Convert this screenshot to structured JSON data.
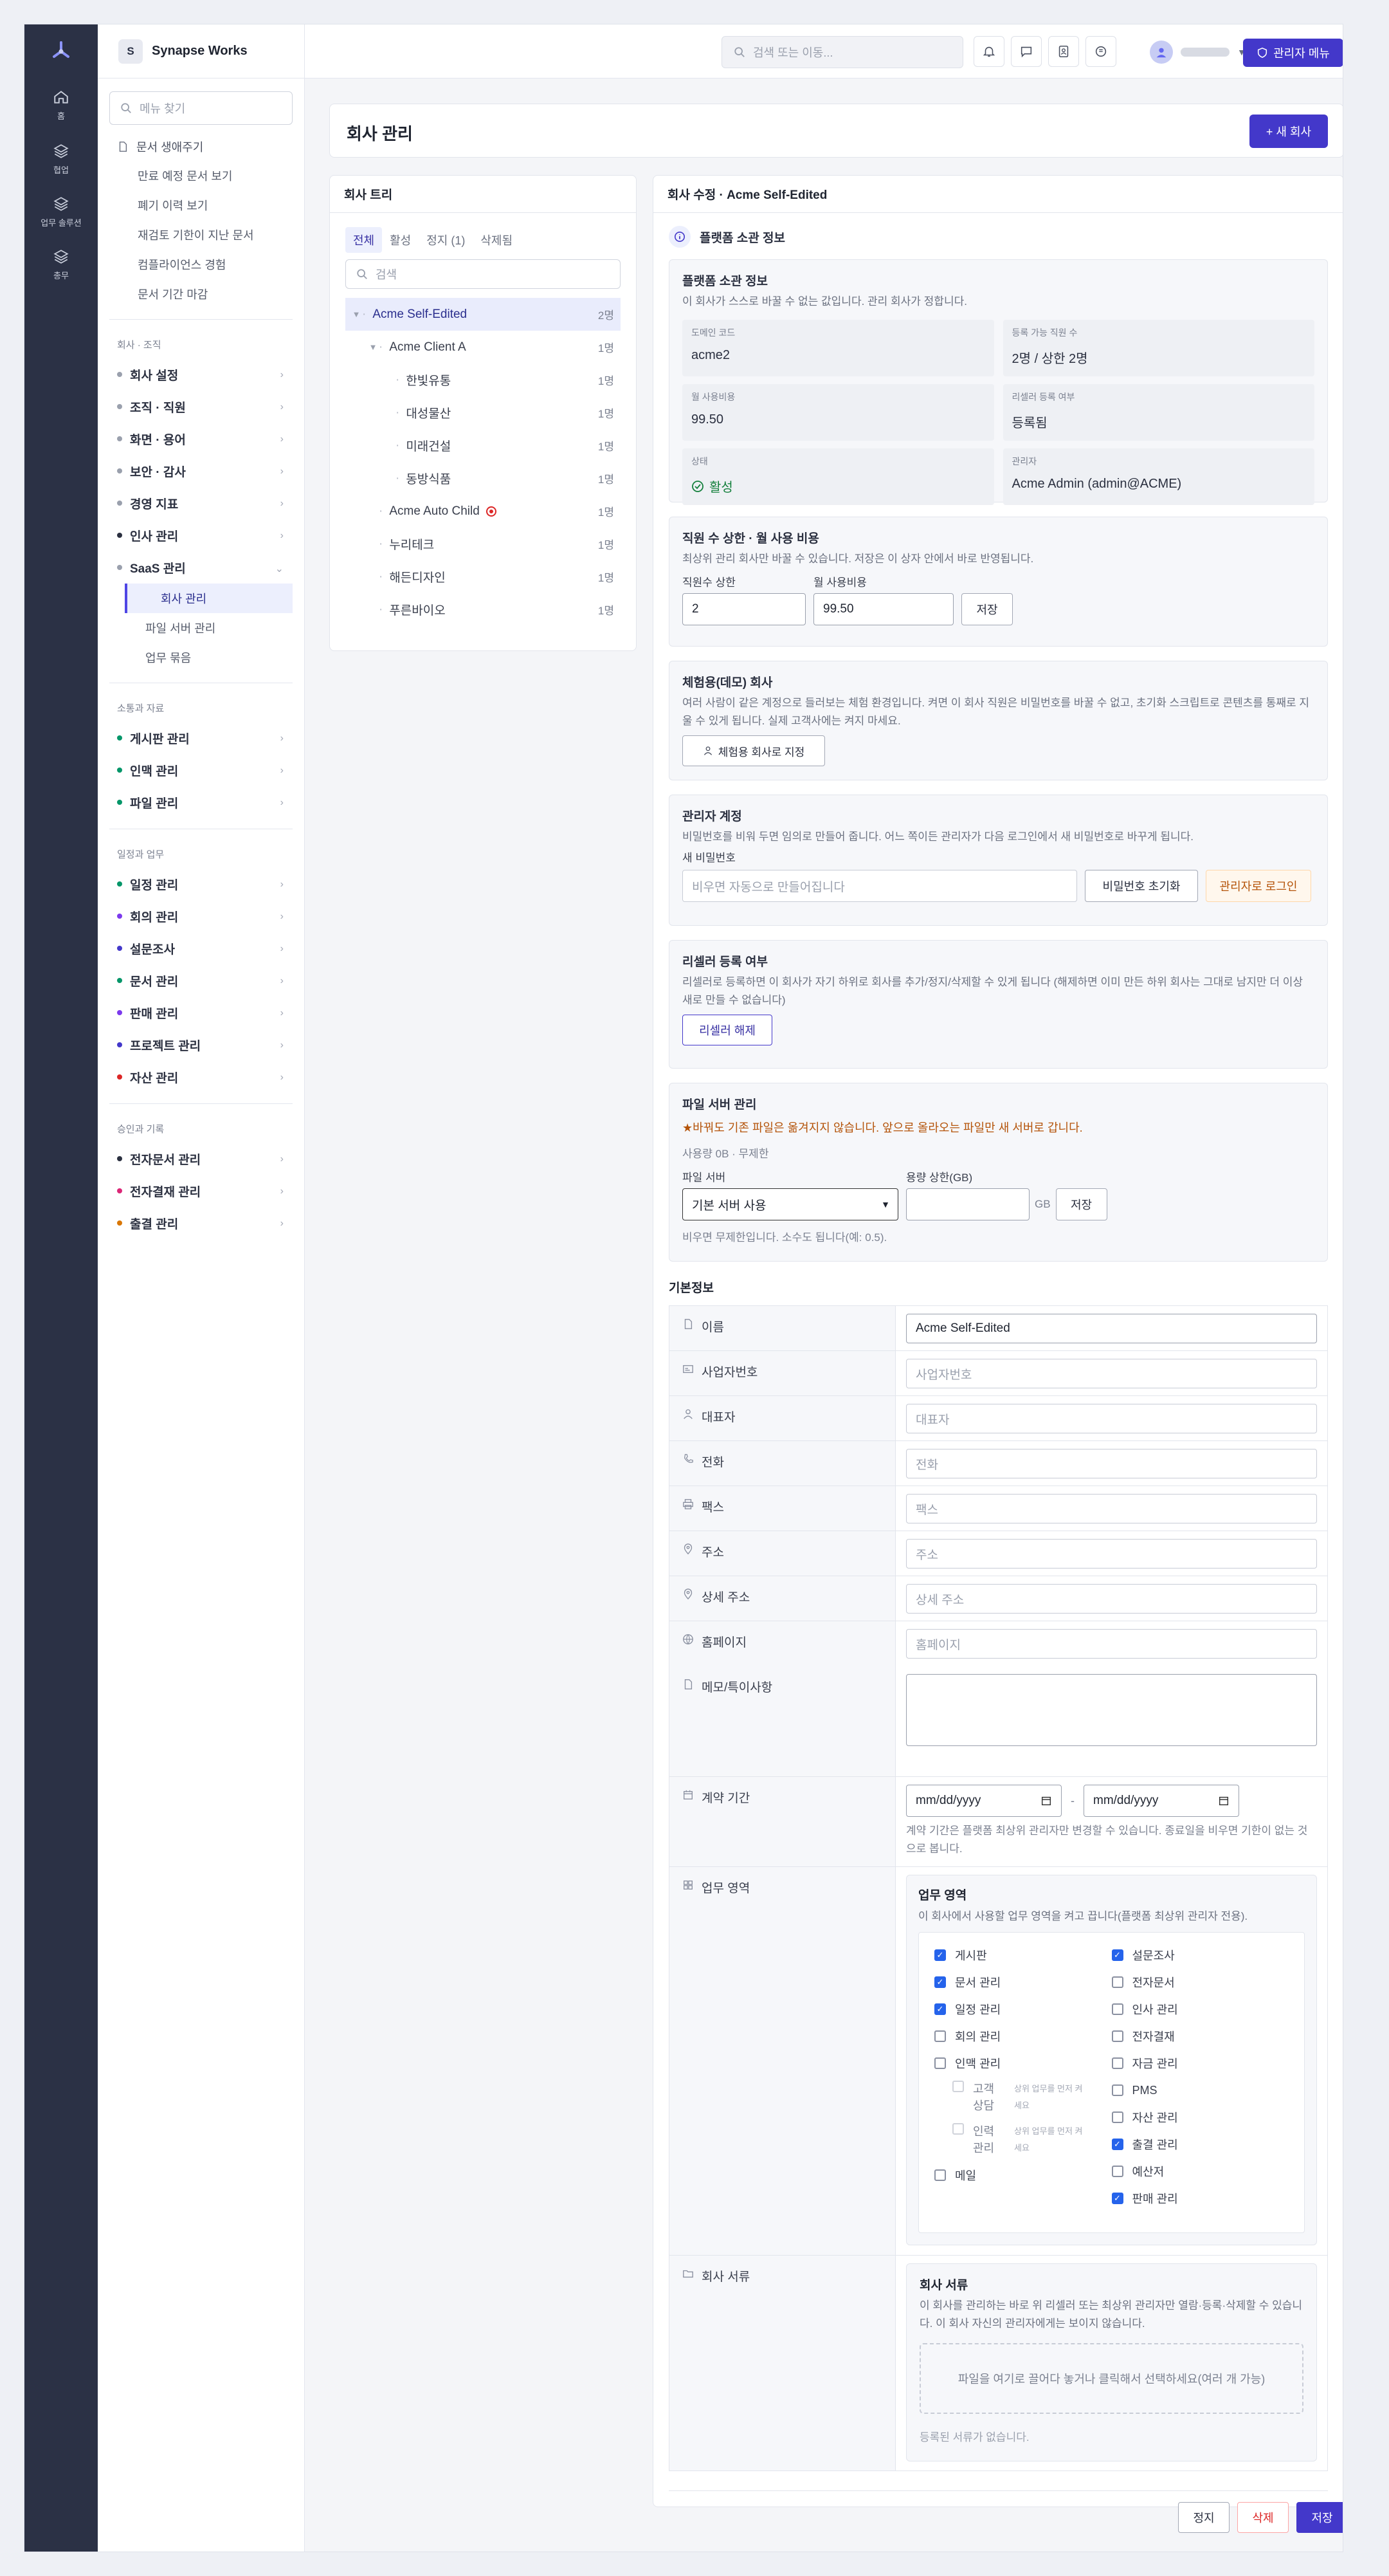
{
  "rail": {
    "items": [
      {
        "label": "홈",
        "icon": "home-icon"
      },
      {
        "label": "협업",
        "icon": "layers-icon"
      },
      {
        "label": "업무 솔루션",
        "icon": "layers-icon"
      },
      {
        "label": "총무",
        "icon": "layers-icon"
      }
    ]
  },
  "brand": {
    "initial": "S",
    "name": "Synapse Works"
  },
  "menu_search": {
    "placeholder": "메뉴 찾기"
  },
  "doc_lifecycle": {
    "title": "문서 생애주기",
    "items": [
      "만료 예정 문서 보기",
      "폐기 이력 보기",
      "재검토 기한이 지난 문서",
      "컴플라이언스 경험",
      "문서 기간 마감"
    ]
  },
  "sidebar": {
    "sections": [
      {
        "category": "회사 · 조직",
        "items": [
          {
            "label": "회사 설정",
            "color": "#9aa0ad"
          },
          {
            "label": "조직 · 직원",
            "color": "#9aa0ad"
          },
          {
            "label": "화면 · 용어",
            "color": "#9aa0ad"
          },
          {
            "label": "보안 · 감사",
            "color": "#9aa0ad"
          },
          {
            "label": "경영 지표",
            "color": "#9aa0ad"
          },
          {
            "label": "인사 관리",
            "color": "#2b3040"
          },
          {
            "label": "SaaS 관리",
            "color": "#9aa0ad"
          }
        ]
      },
      {
        "category": "소통과 자료",
        "items": [
          {
            "label": "게시판 관리",
            "color": "#059669"
          },
          {
            "label": "인맥 관리",
            "color": "#059669"
          },
          {
            "label": "파일 관리",
            "color": "#059669"
          }
        ]
      },
      {
        "category": "일정과 업무",
        "items": [
          {
            "label": "일정 관리",
            "color": "#059669"
          },
          {
            "label": "회의 관리",
            "color": "#7c3aed"
          },
          {
            "label": "설문조사",
            "color": "#4338ca"
          },
          {
            "label": "문서 관리",
            "color": "#059669"
          },
          {
            "label": "판매 관리",
            "color": "#7c3aed"
          },
          {
            "label": "프로젝트 관리",
            "color": "#4338ca"
          },
          {
            "label": "자산 관리",
            "color": "#dc2626"
          }
        ]
      },
      {
        "category": "승인과 기록",
        "items": [
          {
            "label": "전자문서 관리",
            "color": "#2b3040"
          },
          {
            "label": "전자결재 관리",
            "color": "#db2777"
          },
          {
            "label": "출결 관리",
            "color": "#d97706"
          }
        ]
      }
    ],
    "saas_children": [
      "회사 관리",
      "파일 서버 관리",
      "업무 묶음"
    ]
  },
  "topbar": {
    "search_placeholder": "검색 또는 이동...",
    "admin_menu_label": "관리자 메뉴"
  },
  "page": {
    "title": "회사 관리",
    "new_button": "+ 새 회사"
  },
  "tree_panel": {
    "title": "회사 트리",
    "tabs": [
      "전체",
      "활성",
      "정지 (1)",
      "삭제됨"
    ],
    "search_placeholder": "검색",
    "rows": [
      {
        "name": "Acme Self-Edited",
        "count": "2명",
        "level": 0,
        "toggle": "▼"
      },
      {
        "name": "Acme Client A",
        "count": "1명",
        "level": 1,
        "toggle": "▼"
      },
      {
        "name": "한빛유통",
        "count": "1명",
        "level": 2
      },
      {
        "name": "대성물산",
        "count": "1명",
        "level": 2
      },
      {
        "name": "미래건설",
        "count": "1명",
        "level": 2
      },
      {
        "name": "동방식품",
        "count": "1명",
        "level": 2
      },
      {
        "name": "Acme Auto Child",
        "count": "1명",
        "level": 1,
        "flag": true
      },
      {
        "name": "누리테크",
        "count": "1명",
        "level": 1
      },
      {
        "name": "해든디자인",
        "count": "1명",
        "level": 1
      },
      {
        "name": "푸른바이오",
        "count": "1명",
        "level": 1
      }
    ]
  },
  "edit": {
    "title": "회사 수정 · Acme Self-Edited",
    "platform_section": "플랫폼 소관 정보",
    "platform_box": {
      "title": "플랫폼 소관 정보",
      "desc": "이 회사가 스스로 바꿀 수 없는 값입니다. 관리 회사가 정합니다.",
      "cells": [
        {
          "k": "도메인 코드",
          "v": "acme2"
        },
        {
          "k": "등록 가능 직원 수",
          "v": "2명 / 상한 2명"
        },
        {
          "k": "월 사용비용",
          "v": "99.50"
        },
        {
          "k": "리셀러 등록 여부",
          "v": "등록됨"
        },
        {
          "k": "상태",
          "v": "활성"
        },
        {
          "k": "관리자",
          "v": "Acme Admin (admin@ACME)"
        }
      ]
    },
    "limit_box": {
      "title": "직원 수 상한 · 월 사용 비용",
      "desc": "최상위 관리 회사만 바꿀 수 있습니다. 저장은 이 상자 안에서 바로 반영됩니다.",
      "limit_label": "직원수 상한",
      "limit_value": "2",
      "fee_label": "월 사용비용",
      "fee_value": "99.50",
      "save": "저장"
    },
    "demo_box": {
      "title": "체험용(데모) 회사",
      "desc": "여러 사람이 같은 계정으로 들러보는 체험 환경입니다. 켜면 이 회사 직원은 비밀번호를 바꿀 수 없고, 초기화 스크립트로 콘텐츠를 통째로 지울 수 있게 됩니다. 실제 고객사에는 켜지 마세요.",
      "button": "체험용 회사로 지정"
    },
    "admin_box": {
      "title": "관리자 계정",
      "desc": "비밀번호를 비워 두면 임의로 만들어 줍니다. 어느 쪽이든 관리자가 다음 로그인에서 새 비밀번호로 바꾸게 됩니다.",
      "pw_label": "새 비밀번호",
      "pw_placeholder": "비우면 자동으로 만들어집니다",
      "reset": "비밀번호 초기화",
      "login_as": "관리자로 로그인"
    },
    "reseller_box": {
      "title": "리셀러 등록 여부",
      "desc": "리셀러로 등록하면 이 회사가 자기 하위로 회사를 추가/정지/삭제할 수 있게 됩니다 (해제하면 이미 만든 하위 회사는 그대로 남지만 더 이상 새로 만들 수 없습니다)",
      "button": "리셀러 해제"
    },
    "file_box": {
      "title": "파일 서버 관리",
      "warning": "★바꿔도 기존 파일은 옮겨지지 않습니다. 앞으로 올라오는 파일만 새 서버로 갑니다.",
      "usage": "사용량 0B · 무제한",
      "server_label": "파일 서버",
      "server_value": "기본 서버 사용",
      "cap_label": "용량 상한(GB)",
      "cap_unit": "GB",
      "save": "저장",
      "hint": "비우면 무제한입니다. 소수도 됩니다(예: 0.5)."
    },
    "basic": {
      "title": "기본정보",
      "fields": [
        {
          "label": "이름",
          "value": "Acme Self-Edited",
          "placeholder": "",
          "icon": "document-icon"
        },
        {
          "label": "사업자번호",
          "value": "",
          "placeholder": "사업자번호",
          "icon": "id-card-icon"
        },
        {
          "label": "대표자",
          "value": "",
          "placeholder": "대표자",
          "icon": "person-icon"
        },
        {
          "label": "전화",
          "value": "",
          "placeholder": "전화",
          "icon": "phone-icon"
        },
        {
          "label": "팩스",
          "value": "",
          "placeholder": "팩스",
          "icon": "printer-icon"
        },
        {
          "label": "주소",
          "value": "",
          "placeholder": "주소",
          "icon": "pin-icon"
        },
        {
          "label": "상세 주소",
          "value": "",
          "placeholder": "상세 주소",
          "icon": "pin-icon"
        },
        {
          "label": "홈페이지",
          "value": "",
          "placeholder": "홈페이지",
          "icon": "globe-icon"
        }
      ],
      "memo_label": "메모/특이사항",
      "contract_label": "계약 기간",
      "date_placeholder": "mm/dd/yyyy",
      "date_sep": "-",
      "contract_hint": "계약 기간은 플랫폼 최상위 관리자만 변경할 수 있습니다. 종료일을 비우면 기한이 없는 것으로 봅니다.",
      "area_label": "업무 영역",
      "area_box": {
        "title": "업무 영역",
        "desc": "이 회사에서 사용할 업무 영역을 켜고 끕니다(플랫폼 최상위 관리자 전용).",
        "left": [
          {
            "label": "게시판",
            "on": true
          },
          {
            "label": "문서 관리",
            "on": true
          },
          {
            "label": "일정 관리",
            "on": true
          },
          {
            "label": "회의 관리",
            "on": false
          },
          {
            "label": "인맥 관리",
            "on": false
          }
        ],
        "sub": [
          {
            "label": "고객 상담",
            "note": "상위 업무를 먼저 켜세요"
          },
          {
            "label": "인력 관리",
            "note": "상위 업무를 먼저 켜세요"
          }
        ],
        "left_last": {
          "label": "메일",
          "on": false
        },
        "right": [
          {
            "label": "설문조사",
            "on": true
          },
          {
            "label": "전자문서",
            "on": false
          },
          {
            "label": "인사 관리",
            "on": false
          },
          {
            "label": "전자결재",
            "on": false
          },
          {
            "label": "자금 관리",
            "on": false
          },
          {
            "label": "PMS",
            "on": false
          },
          {
            "label": "자산 관리",
            "on": false
          },
          {
            "label": "출결 관리",
            "on": true
          },
          {
            "label": "예산저",
            "on": false
          },
          {
            "label": "판매 관리",
            "on": true
          }
        ]
      },
      "docs_label": "회사 서류",
      "docs_box": {
        "title": "회사 서류",
        "desc": "이 회사를 관리하는 바로 위 리셀러 또는 최상위 관리자만 열람·등록·삭제할 수 있습니다. 이 회사 자신의 관리자에게는 보이지 않습니다.",
        "drop": "파일을 여기로 끌어다 놓거나 클릭해서 선택하세요(여러 개 가능)",
        "empty": "등록된 서류가 없습니다."
      }
    },
    "footer": {
      "suspend": "정지",
      "delete": "삭제",
      "save": "저장"
    }
  },
  "colors": {
    "accent": "#4338ca",
    "rail": "#2b3145",
    "danger": "#dc2626",
    "success": "#15803d",
    "warning": "#b45309"
  }
}
